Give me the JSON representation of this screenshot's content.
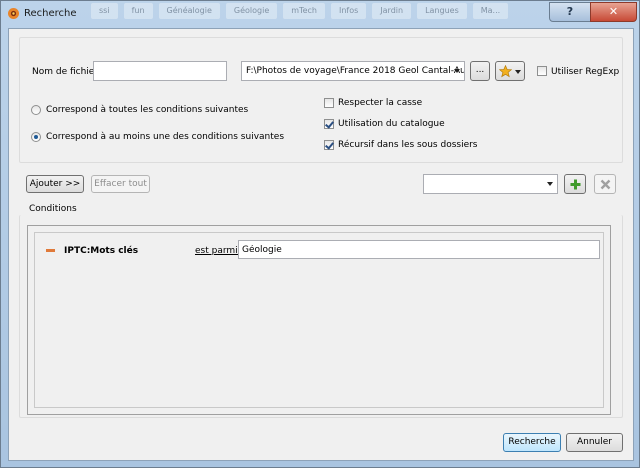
{
  "window": {
    "title": "Recherche",
    "help_label": "?",
    "close_label": "✕",
    "background_tabs": [
      "ssi",
      "fun",
      "Généalogie",
      "Géologie",
      "mTech",
      "Infos",
      "Jardin",
      "Langues",
      "Ma..."
    ]
  },
  "file_section": {
    "filename_label": "Nom de fichier",
    "filename_value": "",
    "folder_value": "F:\\Photos de voyage\\France 2018 Geol Cantal-Aubrac",
    "browse_label": "...",
    "regexp_label": "Utiliser RegExp",
    "regexp_checked": false
  },
  "match_mode": {
    "all_label": "Correspond à toutes les conditions suivantes",
    "any_label": "Correspond à au moins une des conditions suivantes",
    "selected": "any"
  },
  "options": {
    "case_label": "Respecter la casse",
    "case_checked": false,
    "catalog_label": "Utilisation du catalogue",
    "catalog_checked": true,
    "recursive_label": "Récursif dans les sous dossiers",
    "recursive_checked": true
  },
  "toolbar": {
    "add_label": "Ajouter >>",
    "clear_label": "Effacer tout",
    "preset_value": ""
  },
  "conditions": {
    "title": "Conditions",
    "rows": [
      {
        "field": "IPTC:Mots clés",
        "operator": "est parmis",
        "value": "Géologie"
      }
    ]
  },
  "footer": {
    "search_label": "Recherche",
    "cancel_label": "Annuler"
  },
  "colors": {
    "accent_plus": "#3f9a2b",
    "minus": "#e07a3a",
    "star": "#f2b01e"
  }
}
